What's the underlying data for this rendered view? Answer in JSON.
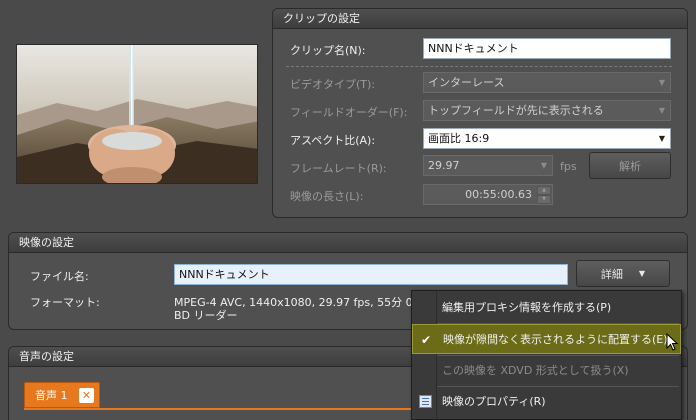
{
  "clip_settings": {
    "title": "クリップの設定",
    "clip_name_label": "クリップ名(N):",
    "clip_name_value": "NNNドキュメント",
    "video_type_label": "ビデオタイプ(T):",
    "video_type_value": "インターレース",
    "field_order_label": "フィールドオーダー(F):",
    "field_order_value": "トップフィールドが先に表示される",
    "aspect_label": "アスペクト比(A):",
    "aspect_value": "画面比 16:9",
    "frame_rate_label": "フレームレート(R):",
    "frame_rate_value": "29.97",
    "fps_label": "fps",
    "analyze_button": "解析",
    "duration_label": "映像の長さ(L):",
    "duration_value": "00:55:00.63"
  },
  "video_settings": {
    "title": "映像の設定",
    "file_name_label": "ファイル名:",
    "file_name_value": "NNNドキュメント",
    "detail_button": "詳細",
    "format_label": "フォーマット:",
    "format_line1": "MPEG-4 AVC,  1440x1080,  29.97 fps,  55分 0",
    "format_line2": "BD リーダー"
  },
  "audio_settings": {
    "title": "音声の設定",
    "tab_label": "音声 1"
  },
  "context_menu": {
    "items": [
      {
        "label": "編集用プロキシ情報を作成する(P)",
        "state": "normal"
      },
      {
        "label": "映像が隙間なく表示されるように配置する(E)",
        "state": "highlighted"
      },
      {
        "label": "この映像を XDVD 形式として扱う(X)",
        "state": "disabled"
      },
      {
        "label": "映像のプロパティ(R)",
        "state": "normal"
      }
    ]
  },
  "colors": {
    "background": "#4a4a4a",
    "highlight": "#6b6b18",
    "tab_orange": "#e8781e"
  }
}
